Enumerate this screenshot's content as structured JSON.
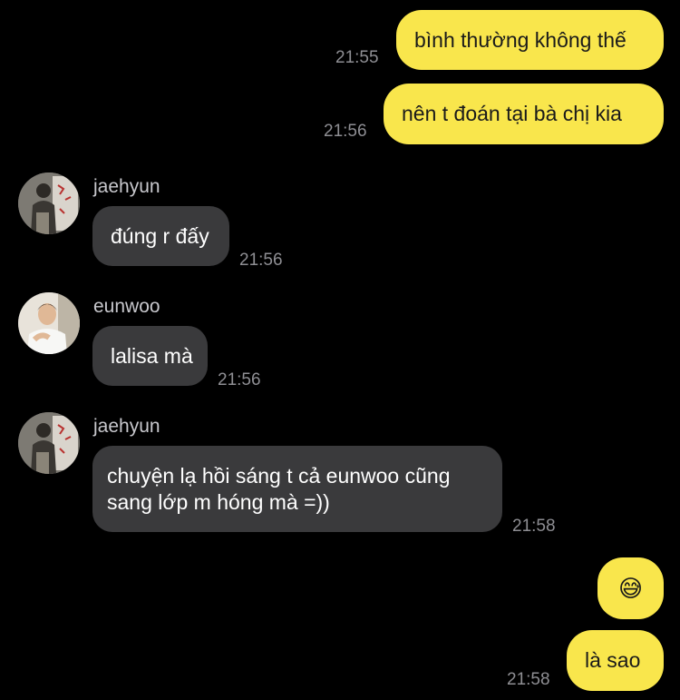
{
  "messages": [
    {
      "kind": "outgoing",
      "text": "bình thường không thế",
      "time": "21:55"
    },
    {
      "kind": "outgoing",
      "text": "nên t đoán tại bà chị kia",
      "time": "21:56"
    },
    {
      "kind": "incoming",
      "sender": "jaehyun",
      "text": "đúng r đấy",
      "time": "21:56"
    },
    {
      "kind": "incoming",
      "sender": "eunwoo",
      "text": "lalisa mà",
      "time": "21:56"
    },
    {
      "kind": "incoming",
      "sender": "jaehyun",
      "text": "chuyện lạ hồi sáng t cả eunwoo cũng sang lớp m hóng mà =))",
      "time": "21:58"
    },
    {
      "kind": "outgoing",
      "text": "😅",
      "time": ""
    },
    {
      "kind": "outgoing",
      "text": "là sao",
      "time": "21:58"
    }
  ],
  "colors": {
    "background": "#000000",
    "outgoing_bubble": "#f9e64c",
    "incoming_bubble": "#3a3a3c",
    "timestamp": "#8e8e93",
    "sender_name": "#c7c7cc"
  }
}
